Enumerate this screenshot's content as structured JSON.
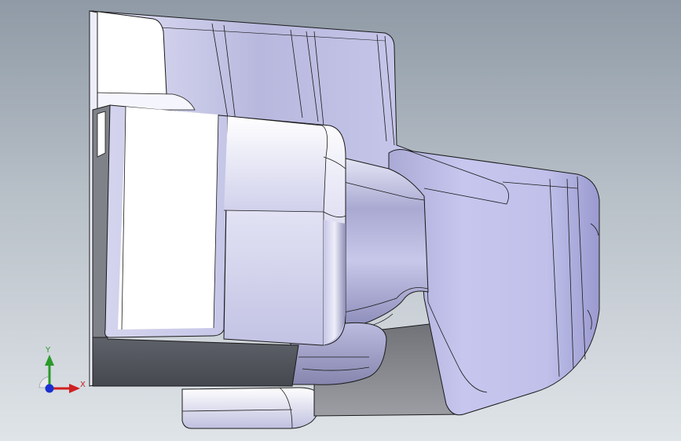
{
  "viewport": {
    "background_top": "#8f9aa6",
    "background_bottom": "#dfe4e8"
  },
  "model": {
    "face_light": "#ffffff",
    "face_lavender": "#c4c4ec",
    "face_dark": "#555a63",
    "edge_color": "#1a1a1a"
  },
  "triad": {
    "y_label": "Y",
    "x_label": "X",
    "y_color": "#2a9a2a",
    "x_color": "#d02020",
    "z_color": "#1a30d0"
  }
}
